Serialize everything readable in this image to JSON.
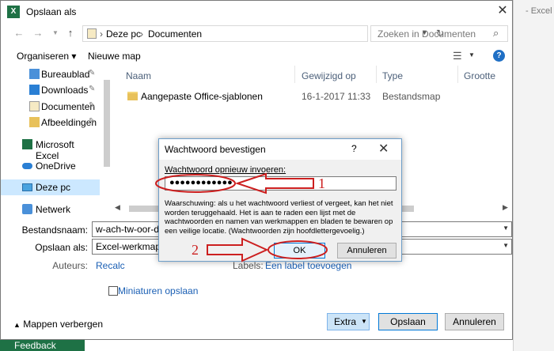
{
  "window": {
    "title": "Opslaan als",
    "close": "✕",
    "app_icon": "X"
  },
  "excel": {
    "title": "- Excel",
    "feedback": "Feedback"
  },
  "address": {
    "segments": [
      "Deze pc",
      "Documenten"
    ],
    "separator": "›"
  },
  "search": {
    "placeholder": "Zoeken in Documenten"
  },
  "toolbar": {
    "organize": "Organiseren ▾",
    "new_folder": "Nieuwe map",
    "help": "?"
  },
  "nav": {
    "items": [
      {
        "label": "Bureaublad",
        "icon": "desktop-folder-icon",
        "pinned": true
      },
      {
        "label": "Downloads",
        "icon": "downloads-folder-icon",
        "pinned": true
      },
      {
        "label": "Documenten",
        "icon": "documents-folder-icon",
        "pinned": true
      },
      {
        "label": "Afbeeldingen",
        "icon": "pictures-folder-icon",
        "pinned": true
      },
      {
        "label": "Microsoft Excel",
        "icon": "excel-icon",
        "pinned": false
      },
      {
        "label": "OneDrive",
        "icon": "onedrive-icon",
        "pinned": false
      },
      {
        "label": "Deze pc",
        "icon": "computer-icon",
        "pinned": false,
        "selected": true
      },
      {
        "label": "Netwerk",
        "icon": "network-icon",
        "pinned": false
      }
    ]
  },
  "file_list": {
    "columns": [
      "Naam",
      "Gewijzigd op",
      "Type",
      "Grootte"
    ],
    "rows": [
      {
        "name": "Aangepaste Office-sjablonen",
        "modified": "16-1-2017 11:33",
        "type": "Bestandsmap",
        "size": ""
      }
    ]
  },
  "form": {
    "filename_label": "Bestandsnaam:",
    "filename_value": "w-ach-tw-oor-d-e",
    "savetype_label": "Opslaan als:",
    "savetype_value": "Excel-werkmap",
    "authors_label": "Auteurs:",
    "authors_value": "Recalc",
    "tags_label": "Labels:",
    "tags_value": "Een label toevoegen",
    "thumbnails_label": "Miniaturen opslaan"
  },
  "bottom": {
    "hide_folders": "Mappen verbergen",
    "extra": "Extra",
    "save": "Opslaan",
    "cancel": "Annuleren"
  },
  "confirm_dialog": {
    "title": "Wachtwoord bevestigen",
    "help": "?",
    "close": "✕",
    "label": "Wachtwoord opnieuw invoeren:",
    "password_value": "●●●●●●●●●●●●",
    "warning": "Waarschuwing: als u het wachtwoord verliest of vergeet, kan het niet worden teruggehaald. Het is aan te raden een lijst met de wachtwoorden en namen van werkmappen en bladen te bewaren op een veilige locatie. (Wachtwoorden zijn hoofdlettergevoelig.)",
    "ok": "OK",
    "cancel": "Annuleren"
  },
  "annotations": {
    "step1": "1",
    "step2": "2",
    "color": "#cc1f1f"
  }
}
